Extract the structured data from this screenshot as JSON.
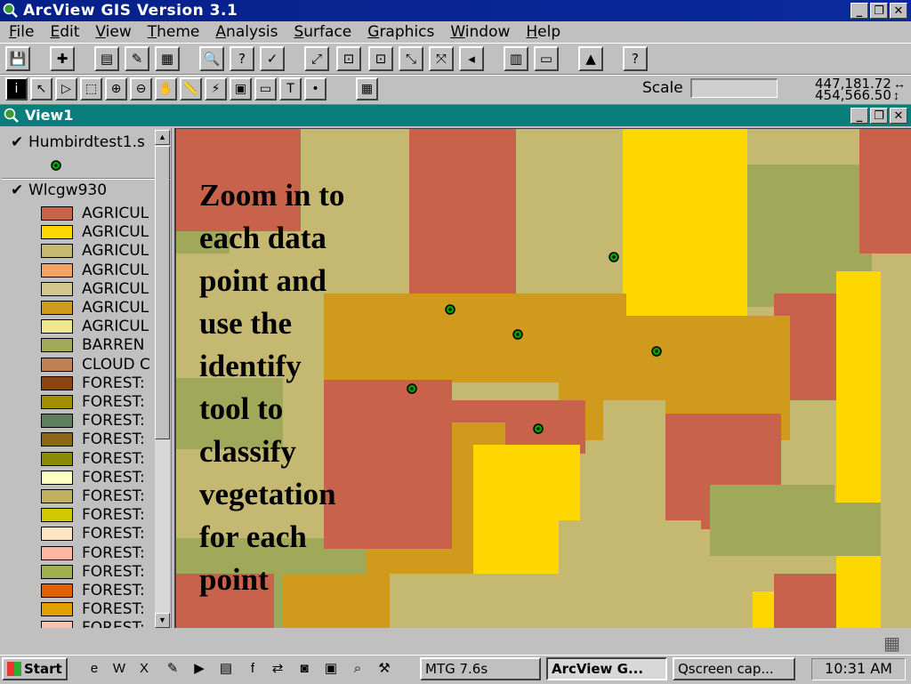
{
  "app": {
    "title": "ArcView GIS Version 3.1"
  },
  "window_controls": {
    "minimize": "_",
    "restore": "❐",
    "close": "✕"
  },
  "menu": [
    {
      "pre": "",
      "u": "F",
      "post": "ile"
    },
    {
      "pre": "",
      "u": "E",
      "post": "dit"
    },
    {
      "pre": "",
      "u": "V",
      "post": "iew"
    },
    {
      "pre": "",
      "u": "T",
      "post": "heme"
    },
    {
      "pre": "",
      "u": "A",
      "post": "nalysis"
    },
    {
      "pre": "",
      "u": "S",
      "post": "urface"
    },
    {
      "pre": "",
      "u": "G",
      "post": "raphics"
    },
    {
      "pre": "",
      "u": "W",
      "post": "indow"
    },
    {
      "pre": "",
      "u": "H",
      "post": "elp"
    }
  ],
  "toolbar": {
    "scale_label": "Scale",
    "scale_value": "",
    "coord_x": "447,181.72",
    "coord_y": "454,566.50",
    "x_arrow": "↔",
    "y_arrow": "↕"
  },
  "view": {
    "title": "View1"
  },
  "toc": {
    "themes": [
      {
        "name": "Humbirdtest1.s",
        "checked": "✔"
      },
      {
        "name": "Wlcgw930",
        "checked": "✔"
      }
    ],
    "legend": [
      {
        "label": "AGRICUL",
        "color": "#c8624a"
      },
      {
        "label": "AGRICUL",
        "color": "#ffd700"
      },
      {
        "label": "AGRICUL",
        "color": "#c5b870"
      },
      {
        "label": "AGRICUL",
        "color": "#f4a460"
      },
      {
        "label": "AGRICUL",
        "color": "#d2c88c"
      },
      {
        "label": "AGRICUL",
        "color": "#d09a1c"
      },
      {
        "label": "AGRICUL",
        "color": "#f0e68c"
      },
      {
        "label": "BARREN",
        "color": "#a0a85a"
      },
      {
        "label": "CLOUD C",
        "color": "#c08050"
      },
      {
        "label": "FOREST:",
        "color": "#8b4513"
      },
      {
        "label": "FOREST:",
        "color": "#a09000"
      },
      {
        "label": "FOREST:",
        "color": "#5f7f5f"
      },
      {
        "label": "FOREST:",
        "color": "#8b6914"
      },
      {
        "label": "FOREST:",
        "color": "#8b8b00"
      },
      {
        "label": "FOREST:",
        "color": "#ffffc0"
      },
      {
        "label": "FOREST:",
        "color": "#c0b060"
      },
      {
        "label": "FOREST:",
        "color": "#d0c800"
      },
      {
        "label": "FOREST:",
        "color": "#ffe4c4"
      },
      {
        "label": "FOREST:",
        "color": "#ffb6a0"
      },
      {
        "label": "FOREST:",
        "color": "#a0b050"
      },
      {
        "label": "FOREST:",
        "color": "#e06000"
      },
      {
        "label": "FOREST:",
        "color": "#e0a000"
      },
      {
        "label": "FOREST:",
        "color": "#ffc0b0"
      }
    ],
    "scroll_up": "▲",
    "scroll_down": "▼"
  },
  "map": {
    "colors": {
      "khaki": "#c5b870",
      "olive": "#a0a85a",
      "brick": "#c8624a",
      "gold": "#d09a1c",
      "yellow": "#ffd700",
      "point": "#00a000"
    },
    "annotation_lines": [
      "Zoom in to",
      "each data",
      "point and",
      "use the",
      "identify",
      "tool to",
      "classify",
      "vegetation",
      "for each",
      "point"
    ]
  },
  "taskbar": {
    "start_label": "Start",
    "tasks": [
      {
        "label": "MTG  7.6s"
      },
      {
        "label": "ArcView G..."
      },
      {
        "label": "Qscreen cap..."
      }
    ],
    "clock": "10:31 AM"
  },
  "icons": {
    "save": "💾",
    "add_theme": "✚",
    "properties": "▤",
    "draw": "✎",
    "table": "▦",
    "find": "🔍",
    "query": "?",
    "locate": "✓",
    "zoom_full": "⤢",
    "zoom_active": "⊡",
    "zoom_in_fixed": "⤡",
    "zoom_out_fixed": "⤧",
    "previous": "◂",
    "layout": "▥",
    "legend": "▭",
    "chart": "▲",
    "help": "?",
    "identify": "i",
    "pointer": "↖",
    "vertex": "▷",
    "select": "⬚",
    "zoom_in": "⊕",
    "zoom_out": "⊖",
    "pan": "✋",
    "measure": "📏",
    "hotlink": "⚡",
    "area": "▣",
    "label": "▭",
    "text": "T",
    "draw_point": "•",
    "snap": "▦"
  }
}
